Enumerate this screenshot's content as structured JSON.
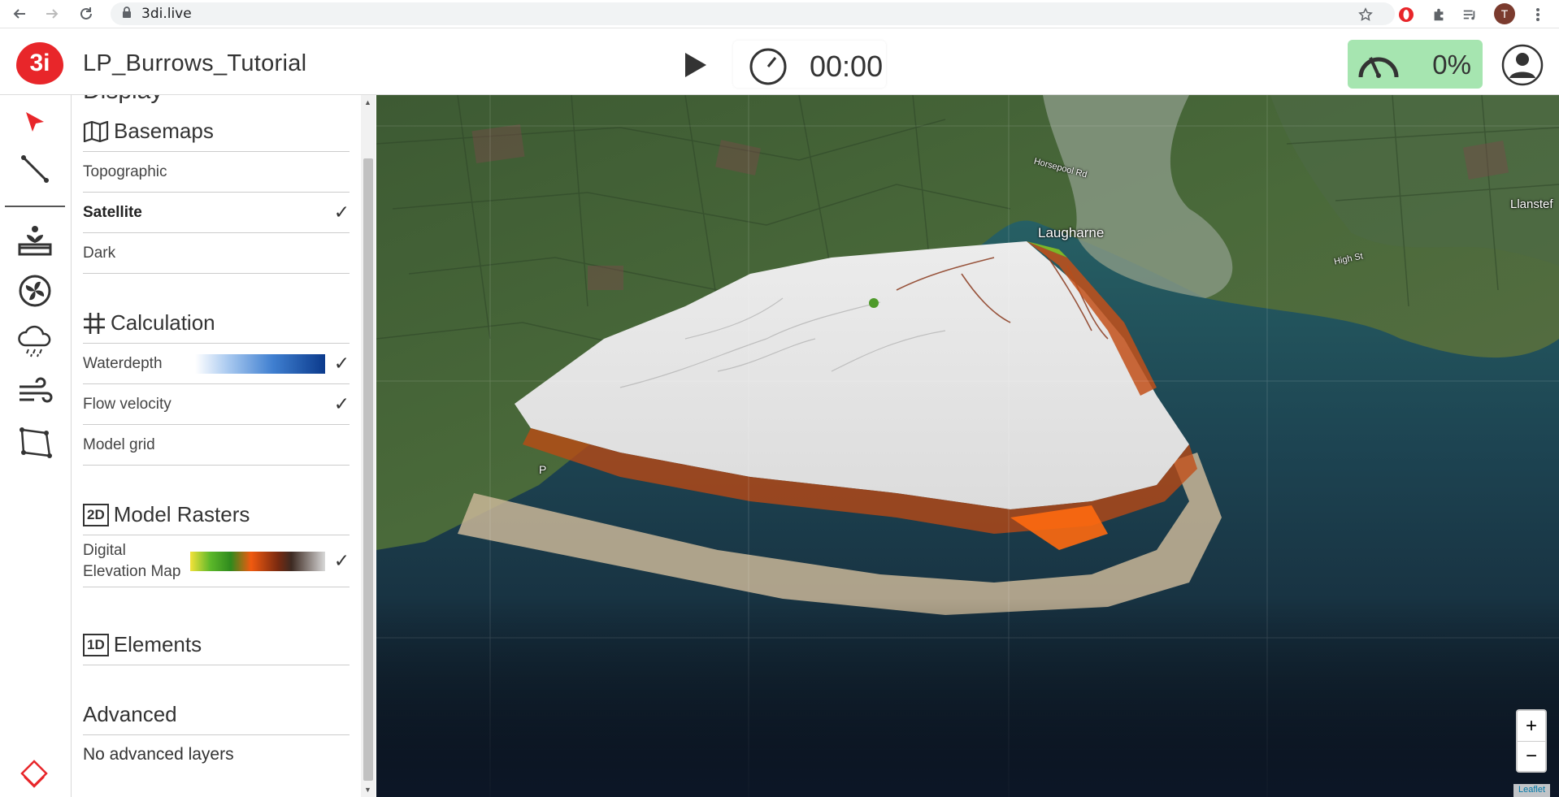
{
  "browser": {
    "url": "3di.live",
    "profile_initial": "T"
  },
  "header": {
    "model_name": "LP_Burrows_Tutorial",
    "logo_text": "3i",
    "timer": "00:00",
    "progress": "0%"
  },
  "toolbar": {
    "tools": [
      "select-icon",
      "line-icon",
      "source-icon",
      "pump-icon",
      "rain-icon",
      "wind-icon",
      "polygon-icon"
    ]
  },
  "panel": {
    "partial_header": "Display",
    "sections": {
      "basemaps": {
        "title": "Basemaps",
        "items": [
          {
            "label": "Topographic",
            "checked": false
          },
          {
            "label": "Satellite",
            "checked": true
          },
          {
            "label": "Dark",
            "checked": false
          }
        ]
      },
      "calculation": {
        "title": "Calculation",
        "items": [
          {
            "label": "Waterdepth",
            "checked": true
          },
          {
            "label": "Flow velocity",
            "checked": true
          },
          {
            "label": "Model grid",
            "checked": false
          }
        ]
      },
      "rasters": {
        "badge": "2D",
        "title": "Model Rasters",
        "items": [
          {
            "label_line1": "Digital",
            "label_line2": "Elevation Map",
            "checked": true
          }
        ]
      },
      "elements": {
        "badge": "1D",
        "title": "Elements"
      },
      "advanced": {
        "title": "Advanced",
        "empty_text": "No advanced layers"
      }
    },
    "check_mark": "✓"
  },
  "map": {
    "labels": {
      "town": "Laugharne",
      "road1": "Horsepool Rd",
      "road2": "High St",
      "town_edge": "Llanstef",
      "edge_letter": "P"
    },
    "zoom_in": "+",
    "zoom_out": "−",
    "attribution": "Leaflet"
  },
  "colors": {
    "accent_red": "#e8262a",
    "progress_green": "#a6e5b0",
    "waterdepth_dark": "#0b3a8c"
  }
}
